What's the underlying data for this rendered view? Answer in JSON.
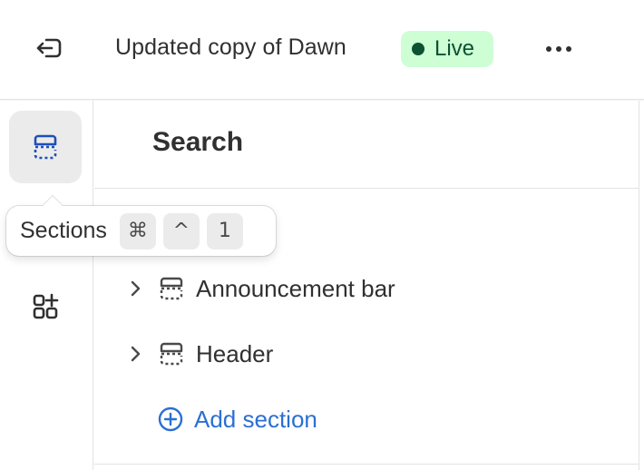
{
  "topbar": {
    "exit_icon": "exit-icon",
    "theme_title": "Updated copy of Dawn",
    "status_badge": "Live",
    "more_icon": "more-horizontal-icon"
  },
  "rail": {
    "items": [
      {
        "id": "sections",
        "icon": "sections-icon",
        "active": true
      },
      {
        "id": "apps",
        "icon": "apps-add-icon",
        "active": false
      }
    ]
  },
  "panel": {
    "title": "Search",
    "sections": [
      {
        "label": "Announcement bar",
        "icon": "section-icon",
        "expand_icon": "chevron-right-icon"
      },
      {
        "label": "Header",
        "icon": "section-icon",
        "expand_icon": "chevron-right-icon"
      }
    ],
    "add_section_label": "Add section",
    "add_icon": "plus-circle-icon"
  },
  "tooltip": {
    "label": "Sections",
    "shortcut": [
      "⌘",
      "^",
      "1"
    ]
  },
  "colors": {
    "live_bg": "#cdfed4",
    "live_text": "#0c5132",
    "accent_blue": "#2b6fd3",
    "rail_active_bg": "#ebebeb",
    "text": "#303030"
  }
}
